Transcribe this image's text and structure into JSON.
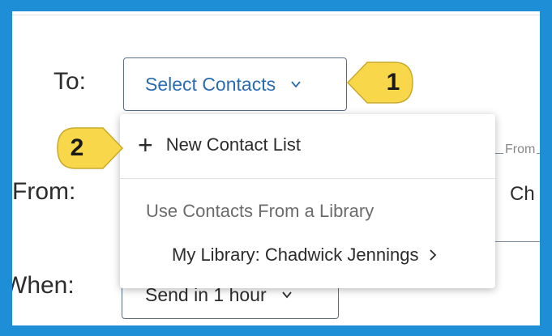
{
  "form": {
    "to_label": "To:",
    "from_label": "From:",
    "when_label": "When:",
    "select_contacts": "Select Contacts",
    "from_field_label": "From",
    "from_field_value": "Ch",
    "send_time": "Send in 1 hour"
  },
  "dropdown": {
    "new_contact_list": "New Contact List",
    "section_heading": "Use Contacts From a Library",
    "library_item": "My Library: Chadwick Jennings"
  },
  "callouts": {
    "first": "1",
    "second": "2"
  },
  "colors": {
    "frame_border": "#1e8fd6",
    "callout_fill": "#f8d84a",
    "link_blue": "#2b6cb0"
  },
  "icons": {
    "dropdown_chevron": "chevron-down-icon",
    "add": "plus-icon",
    "submenu": "chevron-right-icon"
  }
}
